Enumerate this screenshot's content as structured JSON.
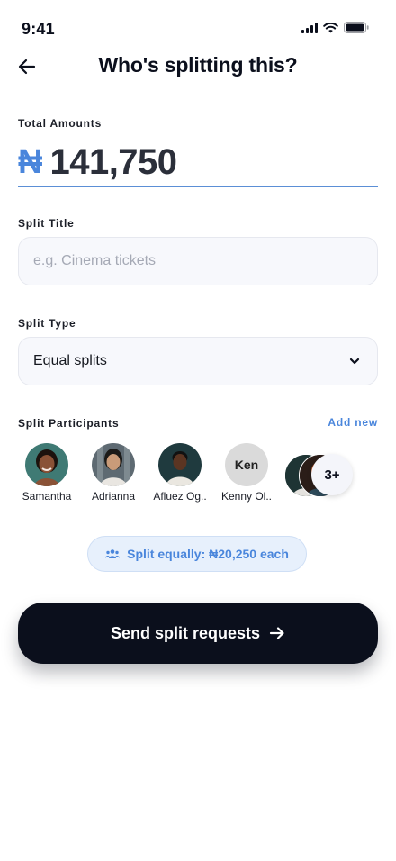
{
  "status_bar": {
    "time": "9:41",
    "icons": [
      "signal-icon",
      "wifi-icon",
      "battery-icon"
    ]
  },
  "header": {
    "title": "Who's splitting this?",
    "back_icon": "arrow-left-icon"
  },
  "total": {
    "label": "Total Amounts",
    "currency_symbol": "₦",
    "amount": "141,750"
  },
  "split_title": {
    "label": "Split Title",
    "placeholder": "e.g. Cinema tickets",
    "value": ""
  },
  "split_type": {
    "label": "Split Type",
    "selected": "Equal splits",
    "icon": "chevron-down-icon"
  },
  "participants": {
    "label": "Split Participants",
    "add_new": "Add new",
    "people": [
      {
        "name": "Samantha"
      },
      {
        "name": "Adrianna"
      },
      {
        "name": "Afluez Og.."
      },
      {
        "name": "Kenny Ol..",
        "initials": "Ken"
      }
    ],
    "more_label": "3+"
  },
  "summary": {
    "text": "Split equally: ₦20,250 each",
    "icon": "people-icon"
  },
  "cta": {
    "label": "Send split requests",
    "icon": "arrow-right-icon"
  },
  "colors": {
    "accent": "#4a86dc",
    "primary_dark": "#0b0f1c",
    "input_bg": "#f7f8fc",
    "pill_bg": "#e7f0fc"
  }
}
